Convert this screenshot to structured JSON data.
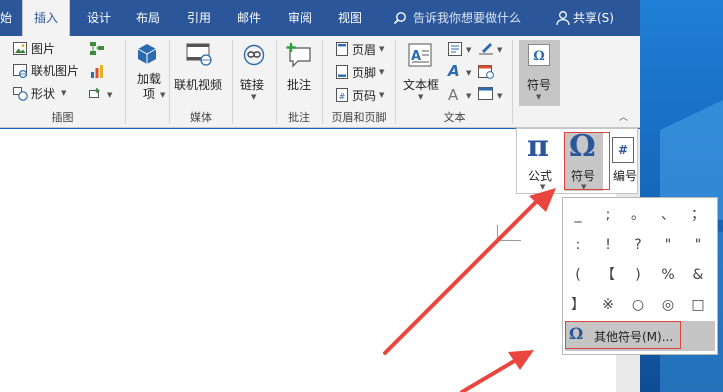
{
  "tabs": {
    "partial": "始",
    "insert": "插入",
    "design": "设计",
    "layout": "布局",
    "references": "引用",
    "mailings": "邮件",
    "review": "审阅",
    "view": "视图",
    "tell_me": "告诉我你想要做什么",
    "share": "共享(S)"
  },
  "ribbon": {
    "illustrations": {
      "picture": "图片",
      "online_picture": "联机图片",
      "shapes": "形状",
      "label": "插图"
    },
    "addins": {
      "label": "加载项"
    },
    "media": {
      "online_video": "联机视频",
      "label": "媒体"
    },
    "links": {
      "link": "链接"
    },
    "comments": {
      "comment": "批注",
      "label": "批注"
    },
    "header_footer": {
      "header": "页眉",
      "footer": "页脚",
      "page_number": "页码",
      "label": "页眉和页脚"
    },
    "text": {
      "textbox": "文本框",
      "label": "文本"
    },
    "symbols": {
      "symbol": "符号"
    }
  },
  "flyout": {
    "equation_glyph": "π",
    "equation": "公式",
    "symbol_glyph": "Ω",
    "symbol": "符号",
    "number_glyph": "#",
    "number": "编号"
  },
  "symbol_grid": [
    "_",
    ";",
    "。",
    "、",
    "；",
    ":",
    "!",
    "?",
    "\"",
    "\"",
    "(",
    "【",
    ")",
    "%",
    "&",
    "】",
    "※",
    "○",
    "◎",
    "□"
  ],
  "more_symbols": {
    "glyph": "Ω",
    "label": "其他符号(M)..."
  },
  "colors": {
    "accent": "#2b579a",
    "highlight": "#e0433b",
    "arrow": "#e8463e"
  }
}
